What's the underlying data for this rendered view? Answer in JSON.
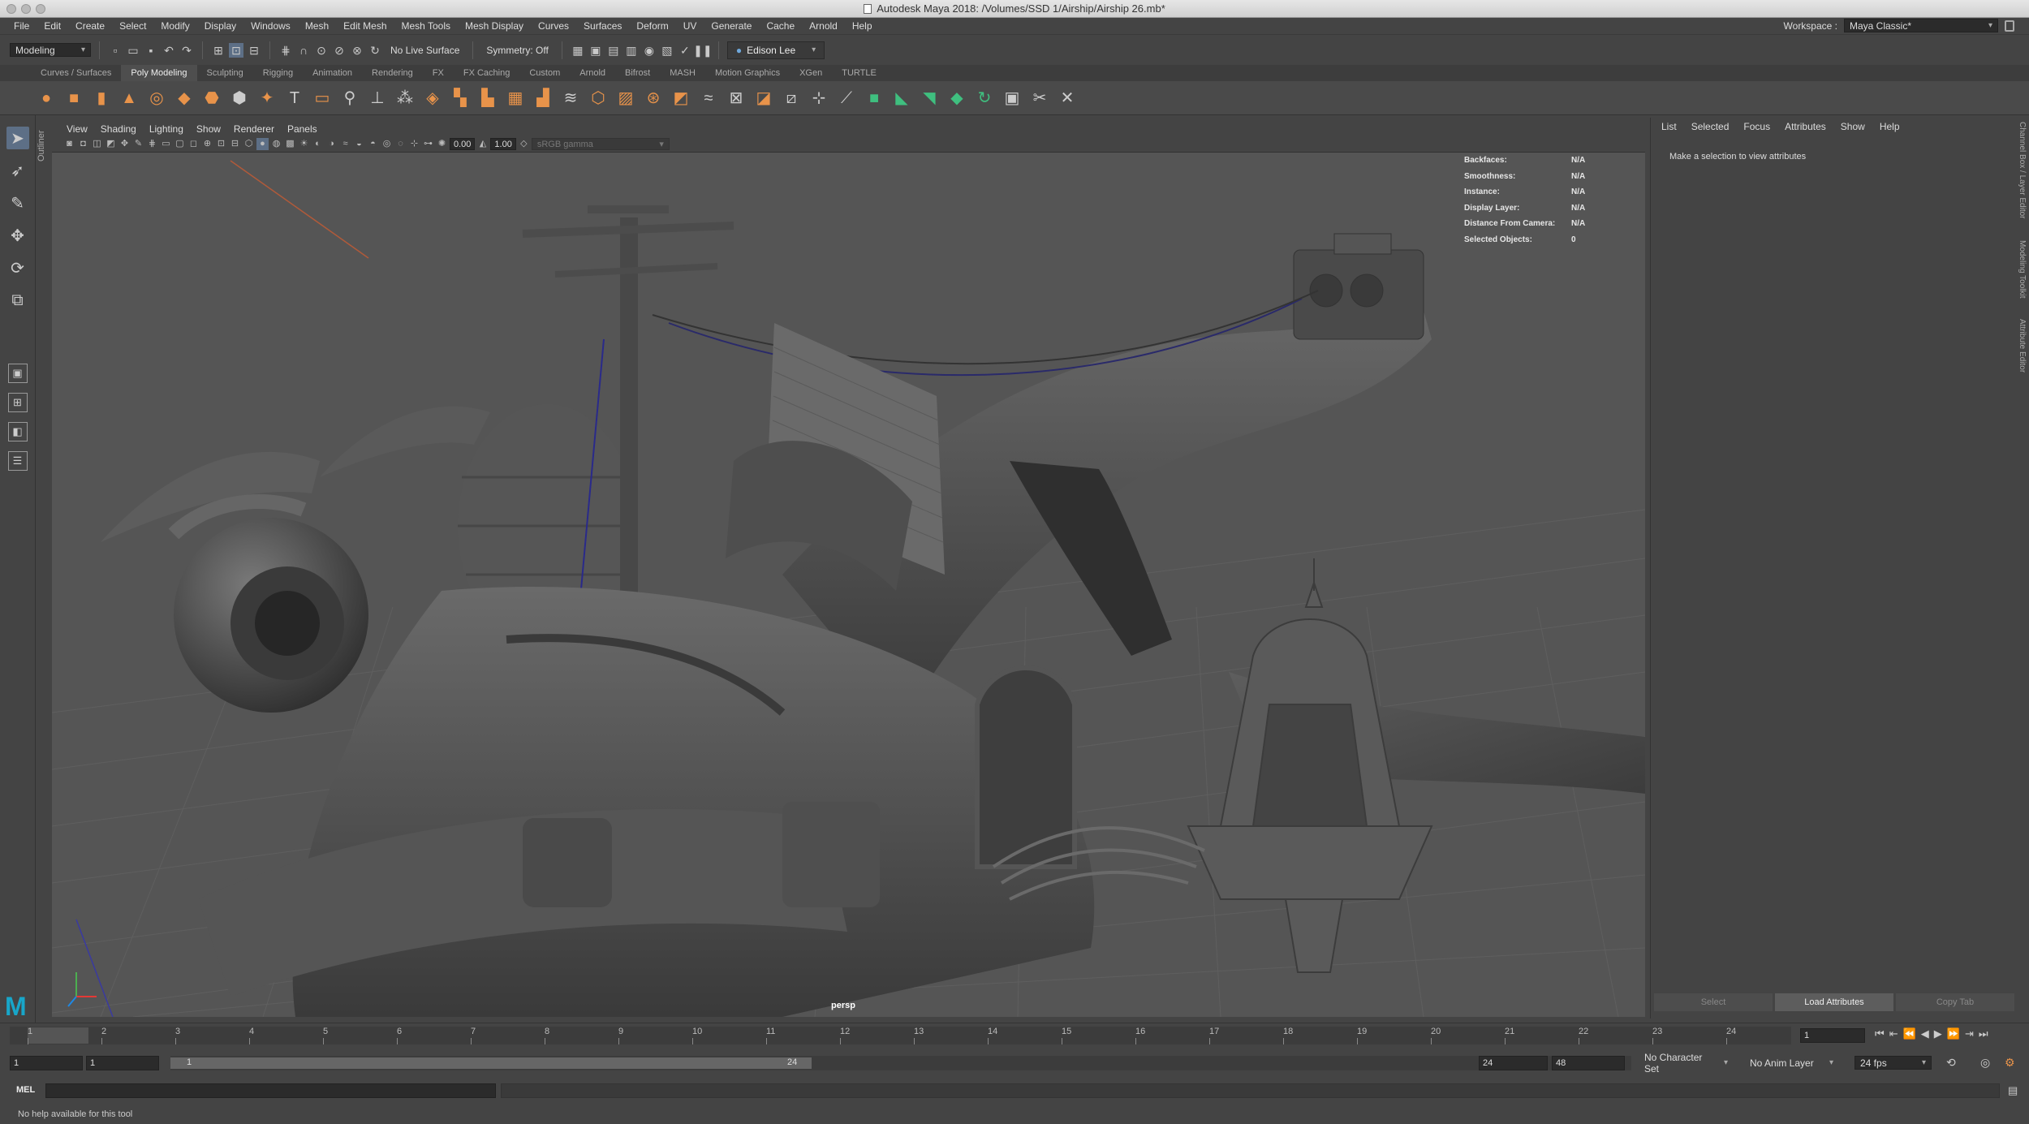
{
  "window": {
    "title": "Autodesk Maya 2018: /Volumes/SSD 1/Airship/Airship 26.mb*"
  },
  "menubar": {
    "items": [
      "File",
      "Edit",
      "Create",
      "Select",
      "Modify",
      "Display",
      "Windows",
      "Mesh",
      "Edit Mesh",
      "Mesh Tools",
      "Mesh Display",
      "Curves",
      "Surfaces",
      "Deform",
      "UV",
      "Generate",
      "Cache",
      "Arnold",
      "Help"
    ],
    "workspace_label": "Workspace :",
    "workspace_value": "Maya Classic*"
  },
  "statusline": {
    "menuset": "Modeling",
    "live_surface": "No Live Surface",
    "symmetry": "Symmetry: Off",
    "user": "Edison Lee"
  },
  "shelf": {
    "tabs": [
      "Curves / Surfaces",
      "Poly Modeling",
      "Sculpting",
      "Rigging",
      "Animation",
      "Rendering",
      "FX",
      "FX Caching",
      "Custom",
      "Arnold",
      "Bifrost",
      "MASH",
      "Motion Graphics",
      "XGen",
      "TURTLE"
    ],
    "active_tab": "Poly Modeling"
  },
  "outliner_tab": "Outliner",
  "viewport": {
    "menu": [
      "View",
      "Shading",
      "Lighting",
      "Show",
      "Renderer",
      "Panels"
    ],
    "exposure": "0.00",
    "gamma": "1.00",
    "colorspace": "sRGB gamma",
    "camera": "persp",
    "hud": [
      {
        "label": "Backfaces:",
        "value": "N/A"
      },
      {
        "label": "Smoothness:",
        "value": "N/A"
      },
      {
        "label": "Instance:",
        "value": "N/A"
      },
      {
        "label": "Display Layer:",
        "value": "N/A"
      },
      {
        "label": "Distance From Camera:",
        "value": "N/A"
      },
      {
        "label": "Selected Objects:",
        "value": "0"
      }
    ]
  },
  "attribute_editor": {
    "menu": [
      "List",
      "Selected",
      "Focus",
      "Attributes",
      "Show",
      "Help"
    ],
    "message": "Make a selection to view attributes",
    "buttons": [
      "Select",
      "Load Attributes",
      "Copy Tab"
    ],
    "side_tabs": [
      "Channel Box / Layer Editor",
      "Modeling Toolkit",
      "Attribute Editor"
    ]
  },
  "timeline": {
    "ticks": [
      "1",
      "2",
      "3",
      "4",
      "5",
      "6",
      "7",
      "8",
      "9",
      "10",
      "11",
      "12",
      "13",
      "14",
      "15",
      "16",
      "17",
      "18",
      "19",
      "20",
      "21",
      "22",
      "23",
      "24"
    ],
    "current_frame": "1"
  },
  "range": {
    "start": "1",
    "anim_start": "1",
    "range_start": "1",
    "range_end": "24",
    "end": "24",
    "anim_end": "48",
    "character_set": "No Character Set",
    "anim_layer": "No Anim Layer",
    "fps": "24 fps"
  },
  "command_line": {
    "language": "MEL"
  },
  "help_line": "No help available for this tool",
  "colors": {
    "accent": "#e8934a",
    "maya_blue": "#18a6c9",
    "selection": "#5d6f86"
  }
}
